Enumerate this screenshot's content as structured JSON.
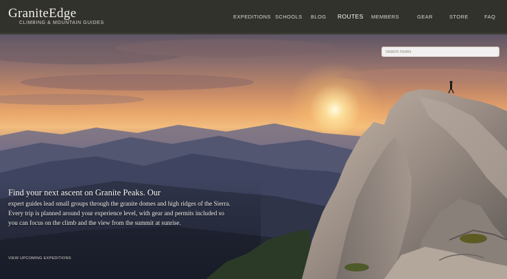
{
  "site": {
    "logo": "GraniteEdge",
    "tagline": "CLIMBING & MOUNTAIN GUIDES"
  },
  "nav": {
    "items": [
      {
        "label": "EXPEDITIONS"
      },
      {
        "label": "SCHOOLS"
      },
      {
        "label": "BLOG"
      },
      {
        "label": "ROUTES"
      },
      {
        "label": "MEMBERS"
      },
      {
        "label": "GEAR"
      },
      {
        "label": "STORE"
      },
      {
        "label": "FAQ"
      }
    ]
  },
  "search": {
    "placeholder": "Search routes"
  },
  "hero": {
    "headline": "Find your next ascent on Granite Peaks. Our",
    "body": "expert guides lead small groups through the granite domes and high ridges of the Sierra. Every trip is planned around your experience level, with gear and permits included so you can focus on the climb and the view from the summit at sunrise.",
    "link_text": "VIEW UPCOMING EXPEDITIONS"
  },
  "colors": {
    "header_bg": "#32322c",
    "sun": "#fff6d8",
    "sky_warm": "#e9a66a",
    "rock": "#9a8f86"
  }
}
